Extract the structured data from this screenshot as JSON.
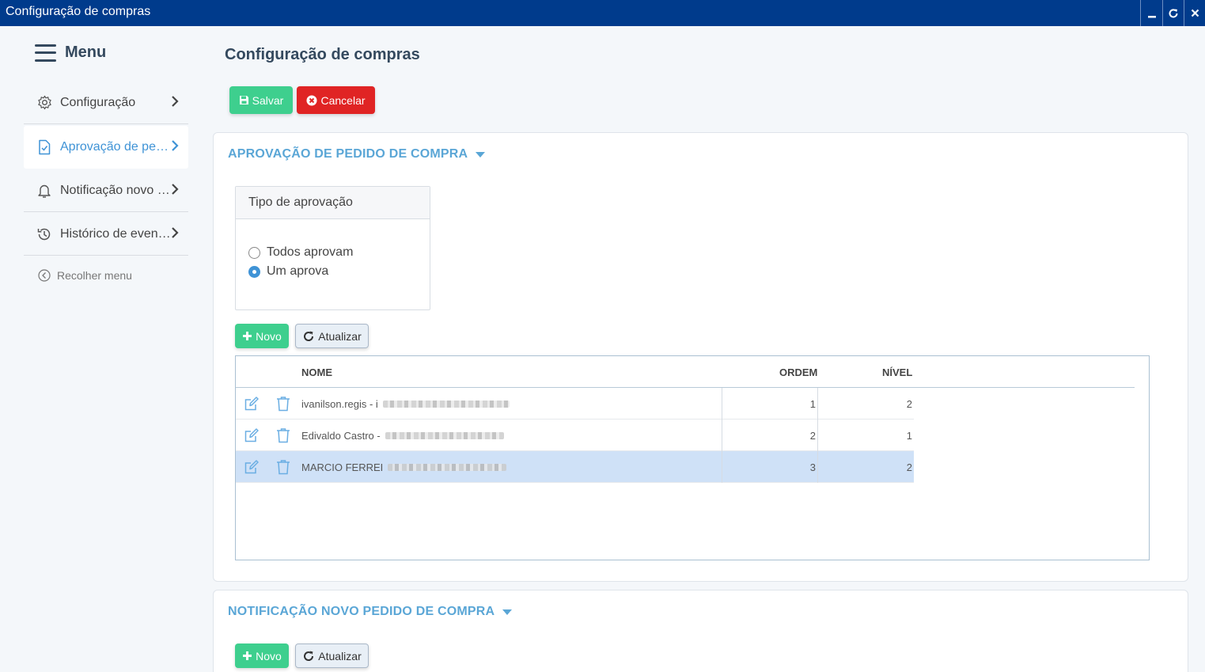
{
  "window": {
    "title": "Configuração de compras",
    "buttons": [
      "minimize-icon",
      "refresh-icon",
      "close-icon"
    ]
  },
  "sidebar": {
    "menu_label": "Menu",
    "items": [
      {
        "label": "Configuração",
        "icon": "gear-icon",
        "active": false
      },
      {
        "label": "Aprovação de pedido de compra",
        "icon": "file-check-icon",
        "active": true
      },
      {
        "label": "Notificação novo pedido de compra",
        "icon": "bell-icon",
        "active": false
      },
      {
        "label": "Histórico de eventos",
        "icon": "history-icon",
        "active": false
      }
    ],
    "collapse_label": "Recolher menu"
  },
  "page": {
    "title": "Configuração de compras",
    "save_label": "Salvar",
    "cancel_label": "Cancelar"
  },
  "approval_section": {
    "title": "APROVAÇÃO DE PEDIDO DE COMPRA",
    "type_box": {
      "header": "Tipo de aprovação",
      "options": [
        {
          "label": "Todos aprovam",
          "selected": false
        },
        {
          "label": "Um aprova",
          "selected": true
        }
      ]
    },
    "new_label": "Novo",
    "refresh_label": "Atualizar",
    "table": {
      "columns": [
        "NOME",
        "ORDEM",
        "NÍVEL"
      ],
      "rows": [
        {
          "name": "ivanilson.regis - i",
          "ordem": "1",
          "nivel": "2",
          "selected": false
        },
        {
          "name": "Edivaldo Castro -",
          "ordem": "2",
          "nivel": "1",
          "selected": false
        },
        {
          "name": "MARCIO FERREI",
          "ordem": "3",
          "nivel": "2",
          "selected": true
        }
      ]
    }
  },
  "notification_section": {
    "title": "NOTIFICAÇÃO NOVO PEDIDO DE COMPRA",
    "new_label": "Novo",
    "refresh_label": "Atualizar"
  },
  "colors": {
    "titlebar": "#003b8c",
    "accent": "#3f93d6",
    "section_title": "#5aa6d6",
    "save": "#3ecf8e",
    "cancel": "#e02424",
    "row_selected": "#cfe1f7"
  }
}
